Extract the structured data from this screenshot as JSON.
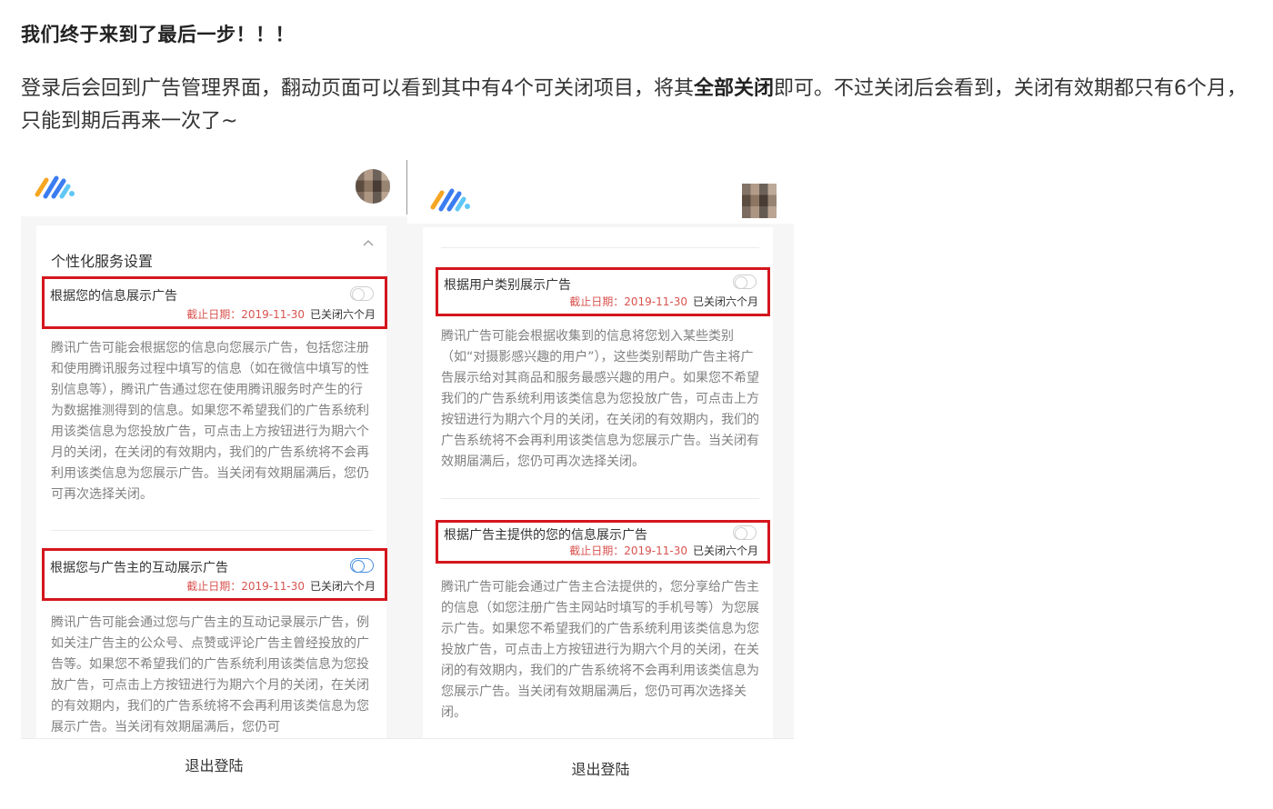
{
  "article": {
    "heading": "我们终于来到了最后一步！！！",
    "para_before": "登录后会回到广告管理界面，翻动页面可以看到其中有4个可关闭项目，将其",
    "para_bold": "全部关闭",
    "para_after": "即可。不过关闭后会看到，关闭有效期都只有6个月，只能到期后再来一次了~"
  },
  "left_screen": {
    "section_title": "个性化服务设置",
    "settings": [
      {
        "title": "根据您的信息展示广告",
        "deadline": "截止日期：2019-11-30",
        "status": "已关闭六个月",
        "description": "腾讯广告可能会根据您的信息向您展示广告，包括您注册和使用腾讯服务过程中填写的信息（如在微信中填写的性别信息等），腾讯广告通过您在使用腾讯服务时产生的行为数据推测得到的信息。如果您不希望我们的广告系统利用该类信息为您投放广告，可点击上方按钮进行为期六个月的关闭，在关闭的有效期内，我们的广告系统将不会再利用该类信息为您展示广告。当关闭有效期届满后，您仍可再次选择关闭。"
      },
      {
        "title": "根据您与广告主的互动展示广告",
        "deadline": "截止日期：2019-11-30",
        "status": "已关闭六个月",
        "description": "腾讯广告可能会通过您与广告主的互动记录展示广告，例如关注广告主的公众号、点赞或评论广告主曾经投放的广告等。如果您不希望我们的广告系统利用该类信息为您投放广告，可点击上方按钮进行为期六个月的关闭，在关闭的有效期内，我们的广告系统将不会再利用该类信息为您展示广告。当关闭有效期届满后，您仍可"
      }
    ],
    "logout_label": "退出登陆"
  },
  "right_screen": {
    "settings": [
      {
        "title": "根据用户类别展示广告",
        "deadline": "截止日期：2019-11-30",
        "status": "已关闭六个月",
        "description": "腾讯广告可能会根据收集到的信息将您划入某些类别（如“对摄影感兴趣的用户”），这些类别帮助广告主将广告展示给对其商品和服务最感兴趣的用户。如果您不希望我们的广告系统利用该类信息为您投放广告，可点击上方按钮进行为期六个月的关闭，在关闭的有效期内，我们的广告系统将不会再利用该类信息为您展示广告。当关闭有效期届满后，您仍可再次选择关闭。"
      },
      {
        "title": "根据广告主提供的您的信息展示广告",
        "deadline": "截止日期：2019-11-30",
        "status": "已关闭六个月",
        "description": "腾讯广告可能会通过广告主合法提供的，您分享给广告主的信息（如您注册广告主网站时填写的手机号等）为您展示广告。如果您不希望我们的广告系统利用该类信息为您投放广告，可点击上方按钮进行为期六个月的关闭，在关闭的有效期内，我们的广告系统将不会再利用该类信息为您展示广告。当关闭有效期届满后，您仍可再次选择关闭。"
      }
    ],
    "logout_label": "退出登陆"
  },
  "colors": {
    "highlight_border": "#d4161d",
    "deadline_text": "#d9534f",
    "toggle_accent": "#4a90e2",
    "logo_blue": "#3b7cf0",
    "logo_orange": "#f5a623",
    "logo_light": "#5fc7f5"
  },
  "icons": {
    "app_logo": "tencent-ads-logo-icon",
    "collapse": "chevron-up-icon",
    "avatar": "user-avatar"
  }
}
